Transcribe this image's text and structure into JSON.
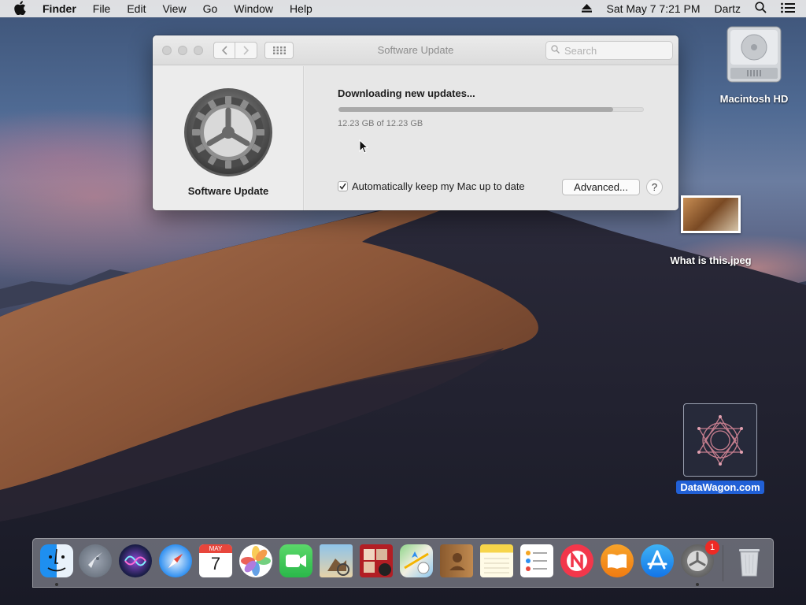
{
  "menubar": {
    "app_name": "Finder",
    "menus": [
      "File",
      "Edit",
      "View",
      "Go",
      "Window",
      "Help"
    ],
    "clock": "Sat May 7  7:21 PM",
    "user": "Dartz"
  },
  "window": {
    "title": "Software Update",
    "search_placeholder": "Search",
    "pane_label": "Software Update",
    "status": "Downloading new updates...",
    "progress_fraction": 0.9,
    "size_text": "12.23 GB of 12.23 GB",
    "auto_update_label": "Automatically keep my Mac up to date",
    "auto_update_checked": true,
    "advanced_label": "Advanced...",
    "help_label": "?"
  },
  "desktop": {
    "icons": [
      {
        "label": "Macintosh HD",
        "icon": "hard-drive-icon"
      },
      {
        "label": "What is this.jpeg",
        "icon": "image-file-icon"
      },
      {
        "label": "DataWagon.com",
        "icon": "webloc-icon"
      }
    ]
  },
  "dock": {
    "apps": [
      {
        "name": "Finder",
        "icon": "finder-icon",
        "running": true
      },
      {
        "name": "Launchpad",
        "icon": "launchpad-icon",
        "running": false
      },
      {
        "name": "Siri",
        "icon": "siri-icon",
        "running": false
      },
      {
        "name": "Safari",
        "icon": "safari-icon",
        "running": false
      },
      {
        "name": "Calendar",
        "icon": "calendar-icon",
        "running": false,
        "month": "MAY",
        "day": "7"
      },
      {
        "name": "Photos",
        "icon": "photos-icon",
        "running": false
      },
      {
        "name": "FaceTime",
        "icon": "facetime-icon",
        "running": false
      },
      {
        "name": "Preview",
        "icon": "preview-icon",
        "running": false
      },
      {
        "name": "Photo Booth",
        "icon": "photo-booth-icon",
        "running": false
      },
      {
        "name": "Maps",
        "icon": "maps-icon",
        "running": false
      },
      {
        "name": "Contacts",
        "icon": "contacts-icon",
        "running": false
      },
      {
        "name": "Notes",
        "icon": "notes-icon",
        "running": false
      },
      {
        "name": "Reminders",
        "icon": "reminders-icon",
        "running": false
      },
      {
        "name": "News",
        "icon": "news-icon",
        "running": false
      },
      {
        "name": "Books",
        "icon": "books-icon",
        "running": false
      },
      {
        "name": "App Store",
        "icon": "app-store-icon",
        "running": false
      },
      {
        "name": "System Preferences",
        "icon": "system-preferences-icon",
        "running": true,
        "badge": "1"
      },
      {
        "name": "Trash",
        "icon": "trash-icon",
        "running": false
      }
    ]
  },
  "colors": {
    "selection_blue": "#2160d6",
    "badge_red": "#ee2a24",
    "progress_fill": "#a9a9a9"
  }
}
